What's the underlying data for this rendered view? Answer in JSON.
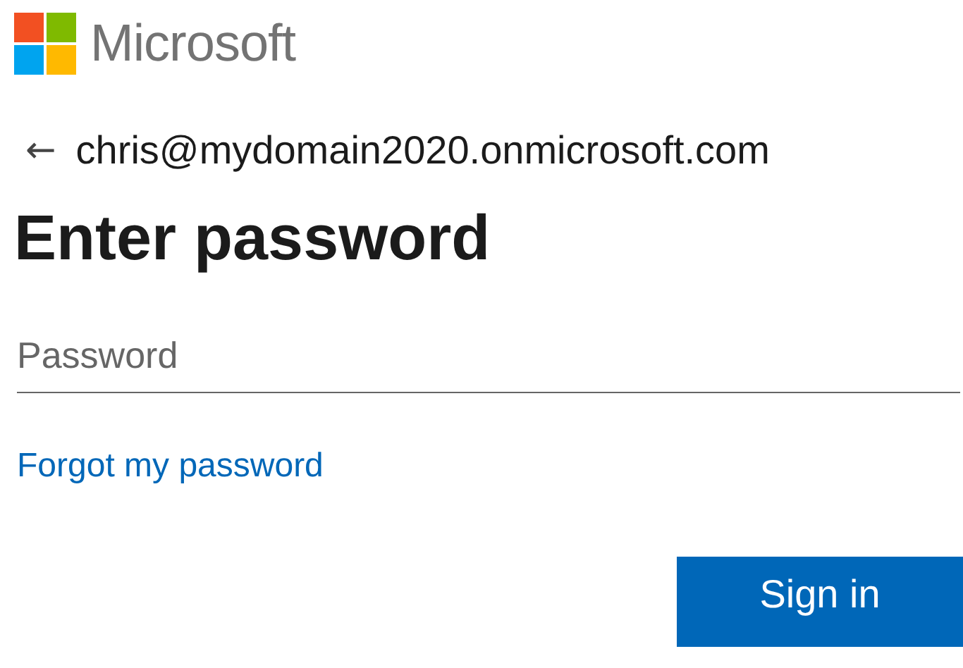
{
  "logo": {
    "text": "Microsoft"
  },
  "identity": {
    "back": "←",
    "email": "chris@mydomain2020.onmicrosoft.com"
  },
  "heading": "Enter password",
  "password_field": {
    "placeholder": "Password"
  },
  "forgot_link": "Forgot my password",
  "buttons": [
    {
      "label": "Sign in",
      "kind": "primary"
    }
  ]
}
